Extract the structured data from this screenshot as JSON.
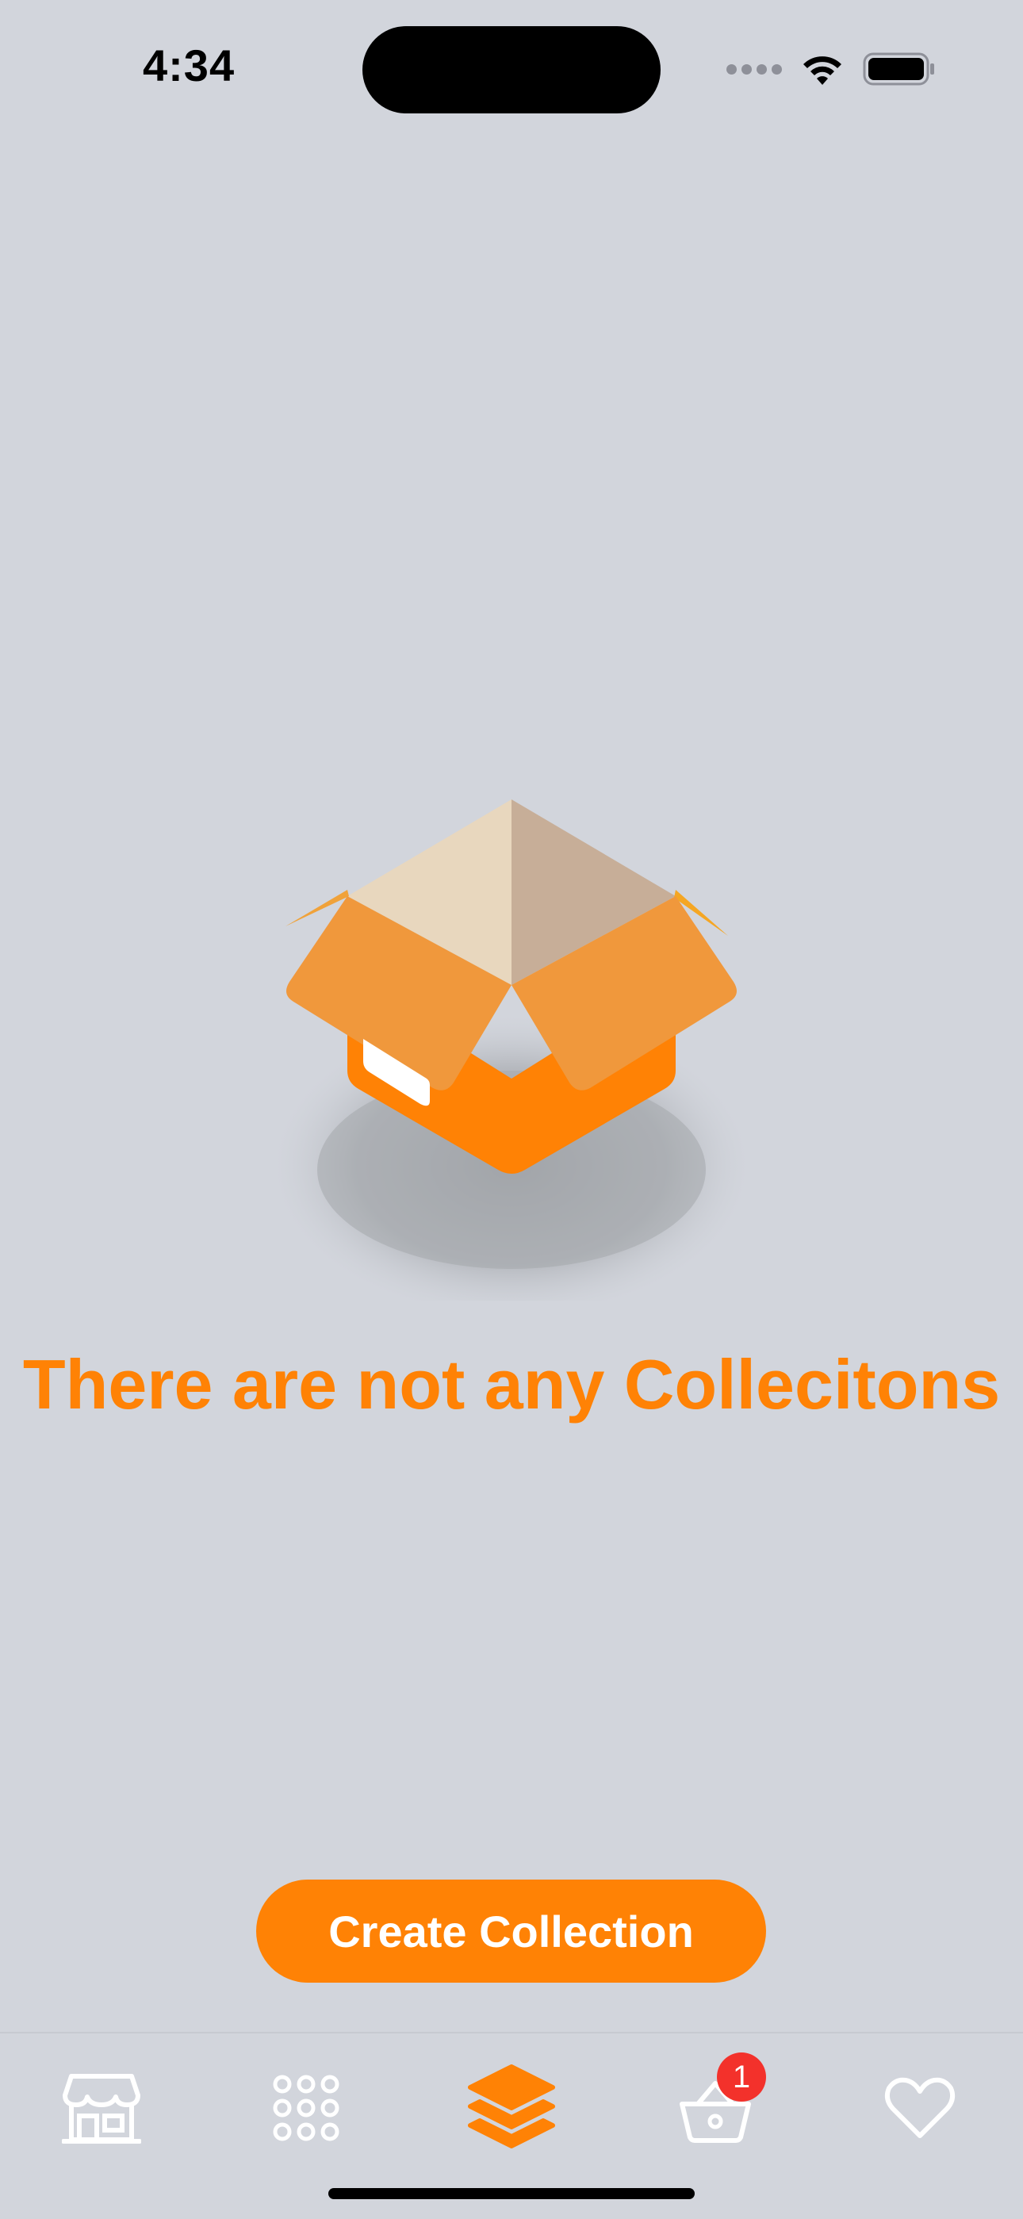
{
  "status_bar": {
    "time": "4:34",
    "icons": [
      "cellular-signal-icon",
      "wifi-icon",
      "battery-icon"
    ]
  },
  "empty_state": {
    "illustration": "open-box-icon",
    "title": "There are not any Collecitons"
  },
  "actions": {
    "create_label": "Create Collection"
  },
  "tab_bar": {
    "tabs": [
      {
        "icon": "store-icon",
        "active": false
      },
      {
        "icon": "grid-icon",
        "active": false
      },
      {
        "icon": "collections-stack-icon",
        "active": true
      },
      {
        "icon": "basket-icon",
        "active": false,
        "badge": "1"
      },
      {
        "icon": "heart-icon",
        "active": false
      }
    ]
  },
  "colors": {
    "accent": "#ff8205",
    "background": "#d2d5dc",
    "badge": "#f3312b",
    "inactive_icon": "#ffffff"
  }
}
